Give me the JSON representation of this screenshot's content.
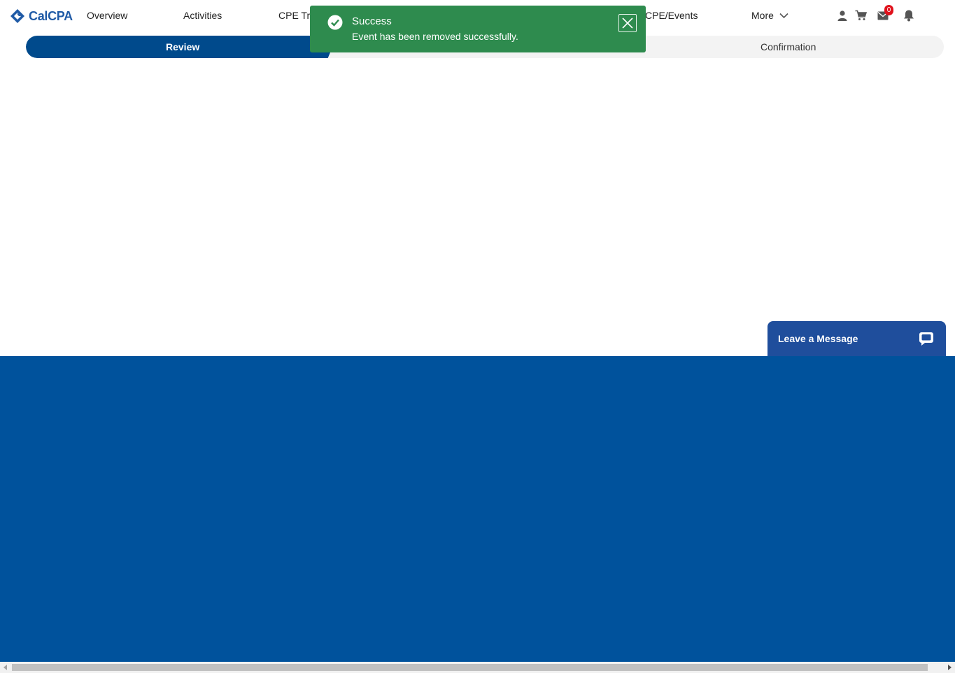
{
  "brand": {
    "name": "CalCPA",
    "color": "#1f5aa6"
  },
  "nav": {
    "items": [
      {
        "label": "Overview"
      },
      {
        "label": "Activities"
      },
      {
        "label": "CPE Tra"
      },
      {
        "label": "CPE/Events"
      }
    ],
    "more_label": "More"
  },
  "header_icons": {
    "user": "user-icon",
    "cart": "cart-icon",
    "mail": "mail-icon",
    "mail_count": "0",
    "bell": "bell-icon"
  },
  "steps": {
    "items": [
      {
        "label": "Review",
        "active": true
      },
      {
        "label": "Confirmation",
        "active": false
      }
    ],
    "active_color": "#004a8c"
  },
  "toast": {
    "title": "Success",
    "message": "Event has been removed successfully.",
    "color": "#2e8b4e"
  },
  "chat": {
    "label": "Leave a Message",
    "color": "#1f4e9c"
  },
  "footer": {
    "color": "#00529c"
  }
}
